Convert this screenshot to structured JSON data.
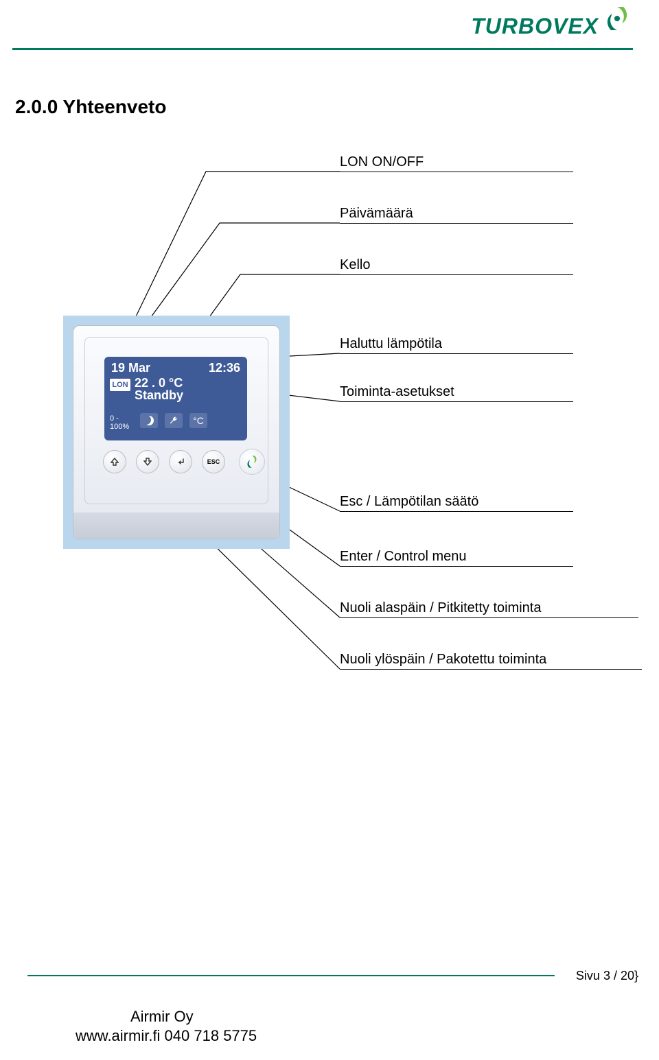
{
  "header": {
    "brand": "TURBOVEX"
  },
  "section": {
    "title": "2.0.0 Yhteenveto"
  },
  "device": {
    "screen": {
      "date": "19 Mar",
      "time": "12:36",
      "lon": "LON",
      "temperature": "22 . 0 °C",
      "mode": "Standby",
      "range_line1": "0 -",
      "range_line2": "100%",
      "degree_icon_label": "°C"
    },
    "buttons": {
      "up": "⇧",
      "down": "⇩",
      "enter": "↵",
      "esc": "ESC"
    }
  },
  "callouts": {
    "lon": "LON ON/OFF",
    "date": "Päivämäärä",
    "clock": "Kello",
    "temp": "Haluttu lämpötila",
    "settings": "Toiminta-asetukset",
    "esc": "Esc / Lämpötilan säätö",
    "enter": "Enter / Control menu",
    "down": "Nuoli alaspäin / Pitkitetty toiminta",
    "up": "Nuoli ylöspäin / Pakotettu toiminta"
  },
  "footer": {
    "page": "Sivu 3 / 20}",
    "company": "Airmir Oy",
    "url": "www.airmir.fi 040 718 5775"
  }
}
